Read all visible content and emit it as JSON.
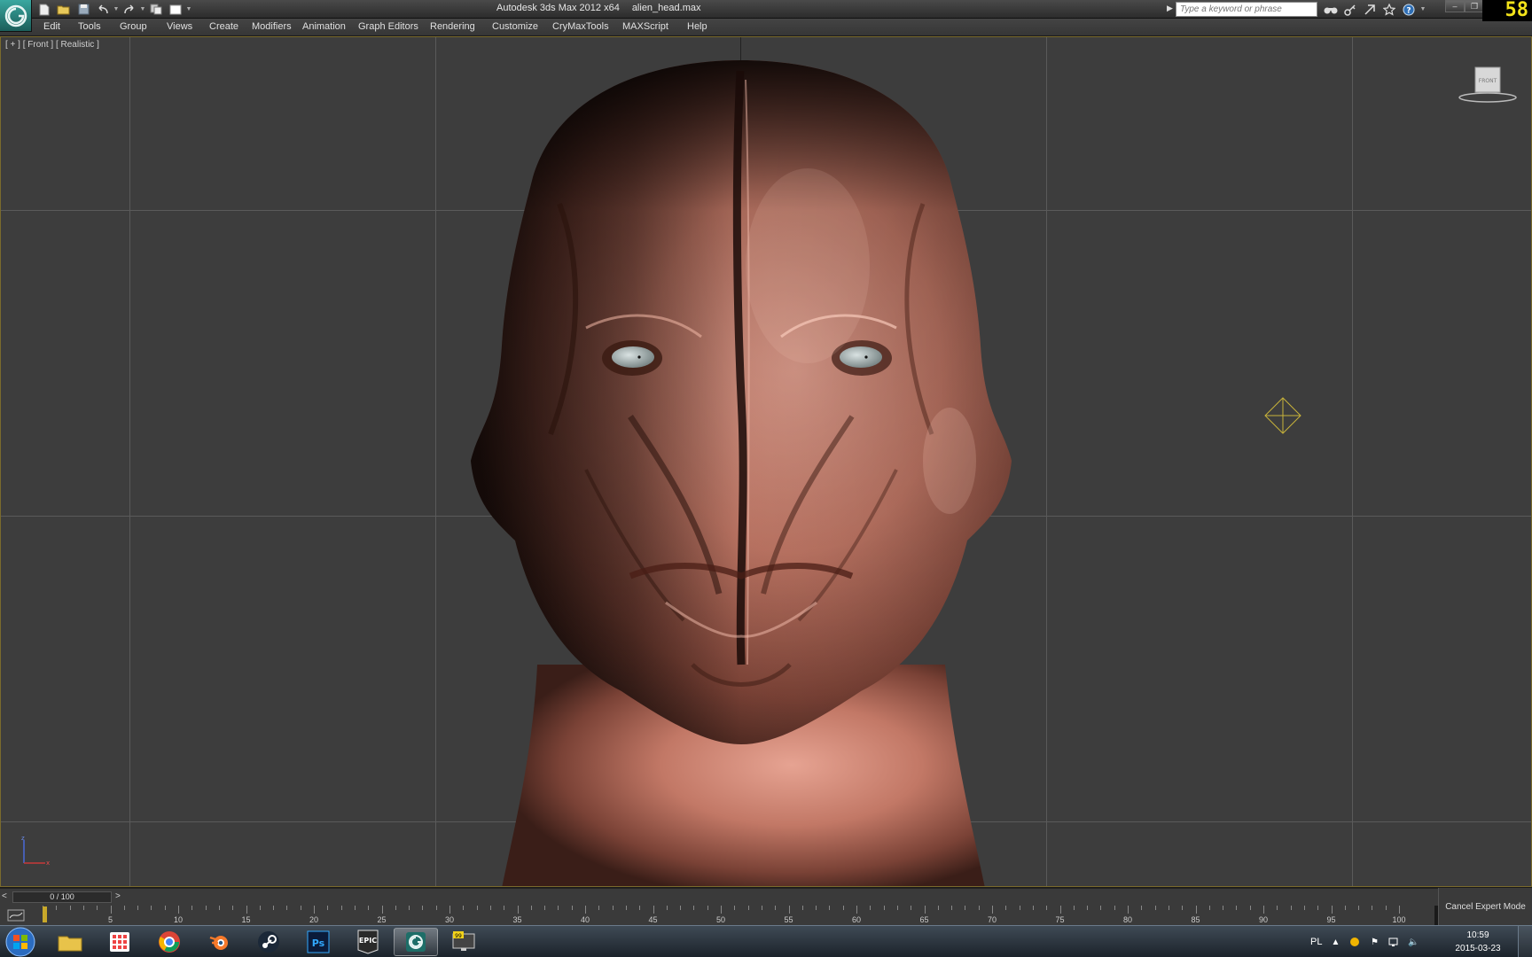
{
  "app": {
    "title": "Autodesk 3ds Max  2012 x64",
    "file_name": "alien_head.max",
    "fps": "58",
    "logo_icon": "3dsmax-logo-icon"
  },
  "search": {
    "placeholder": "Type a keyword or phrase"
  },
  "menu": {
    "items": [
      {
        "label": "Edit"
      },
      {
        "label": "Tools"
      },
      {
        "label": "Group"
      },
      {
        "label": "Views"
      },
      {
        "label": "Create"
      },
      {
        "label": "Modifiers"
      },
      {
        "label": "Animation"
      },
      {
        "label": "Graph Editors"
      },
      {
        "label": "Rendering"
      },
      {
        "label": "Customize"
      },
      {
        "label": "CryMaxTools"
      },
      {
        "label": "MAXScript"
      },
      {
        "label": "Help"
      }
    ]
  },
  "viewport": {
    "label": "[ + ] [ Front ] [ Realistic ]",
    "viewcube_label": "FRONT",
    "background": "#3d3d3d",
    "border_color": "#7a6a2c"
  },
  "timeline": {
    "slider_text": "0 / 100",
    "prev_label": "<",
    "next_label": ">",
    "current_frame": 0,
    "total_frames": 100,
    "tick_labels": [
      "5",
      "10",
      "15",
      "20",
      "25",
      "30",
      "35",
      "40",
      "45",
      "50",
      "55",
      "60",
      "65",
      "70",
      "75",
      "80",
      "85",
      "90",
      "95",
      "100"
    ]
  },
  "status": {
    "cancel_expert_label": "Cancel Expert Mode"
  },
  "taskbar": {
    "apps": [
      "file-explorer",
      "app-launcher",
      "chrome",
      "blender",
      "steam",
      "photoshop",
      "epic-games",
      "3ds-max",
      "monitor-app"
    ],
    "language": "PL",
    "time": "10:59",
    "date": "2015-03-23"
  },
  "colors": {
    "accent": "#f2e21a",
    "skin": "#c8786a"
  }
}
